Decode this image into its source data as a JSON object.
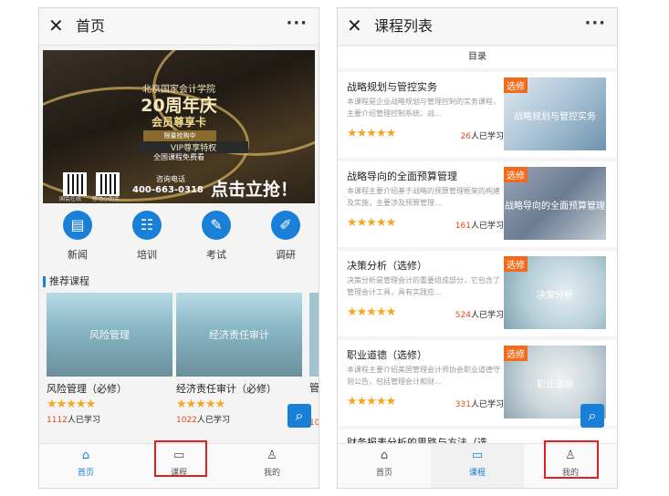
{
  "phone1": {
    "titlebar": {
      "close": "✕",
      "title": "首页",
      "more": "···"
    },
    "banner": {
      "school": "北京国家会计学院",
      "anniversary": "20周年庆",
      "card": "会员尊享卡",
      "limited": "限量抢购中",
      "vip": "VIP尊享特权",
      "free": "全国课程免费看",
      "qr_label_1": "国会在线",
      "qr_label_2": "移动小助手",
      "tel_label": "咨询电话",
      "tel": "400-663-0318",
      "cta": "点击立抢！"
    },
    "nav": [
      {
        "label": "新闻",
        "icon": "news-icon"
      },
      {
        "label": "培训",
        "icon": "training-icon"
      },
      {
        "label": "考试",
        "icon": "exam-icon"
      },
      {
        "label": "调研",
        "icon": "survey-icon"
      }
    ],
    "section_title": "推荐课程",
    "recommended": [
      {
        "img_text": "风险管理",
        "title": "风险管理（必修）",
        "count": "1112",
        "count_suffix": "人已学习"
      },
      {
        "img_text": "经济责任审计",
        "title": "经济责任审计（必修）",
        "count": "1022",
        "count_suffix": "人已学习"
      }
    ],
    "peek_text": "管",
    "peek_count": "10",
    "stars": "★★★★★",
    "tabs": [
      {
        "label": "首页",
        "icon": "home-icon"
      },
      {
        "label": "课程",
        "icon": "course-icon"
      },
      {
        "label": "我的",
        "icon": "user-icon"
      }
    ]
  },
  "phone2": {
    "titlebar": {
      "close": "✕",
      "title": "课程列表",
      "more": "···"
    },
    "subhead": "目录",
    "courses": [
      {
        "title": "战略规划与管控实务",
        "desc": "本课程是企业战略规划与管理控制的实务课程，主要介绍管理控制系统、战…",
        "count": "26",
        "tag": "选修",
        "img_text": "战略规划与管控实务"
      },
      {
        "title": "战略导向的全面预算管理",
        "desc": "本课程主要介绍基于战略的预算管理框架的构建及实施，主要涉及预算管理…",
        "count": "161",
        "tag": "选修",
        "img_text": "战略导向的全面预算管理"
      },
      {
        "title": "决策分析（选修）",
        "desc": "决策分析是管理会计的重要组成部分，它包含了管理会计工具，具有实践应…",
        "count": "524",
        "tag": "选修",
        "img_text": "决策分析"
      },
      {
        "title": "职业道德（选修）",
        "desc": "本课程主要介绍美国管理会计师协会职业道德守则公告，包括管理会计和财…",
        "count": "331",
        "tag": "选修",
        "img_text": "职业道德"
      }
    ],
    "partial_title": "财务报表分析的思路与方法（选",
    "count_suffix": "人已学习",
    "stars": "★★★★★",
    "tabs": [
      {
        "label": "首页",
        "icon": "home-icon"
      },
      {
        "label": "课程",
        "icon": "course-icon"
      },
      {
        "label": "我的",
        "icon": "user-icon"
      }
    ]
  },
  "colors": {
    "accent": "#1a7fd6",
    "star": "#f5a623",
    "tag": "#f26a1b",
    "highlight_box": "#e02020"
  }
}
